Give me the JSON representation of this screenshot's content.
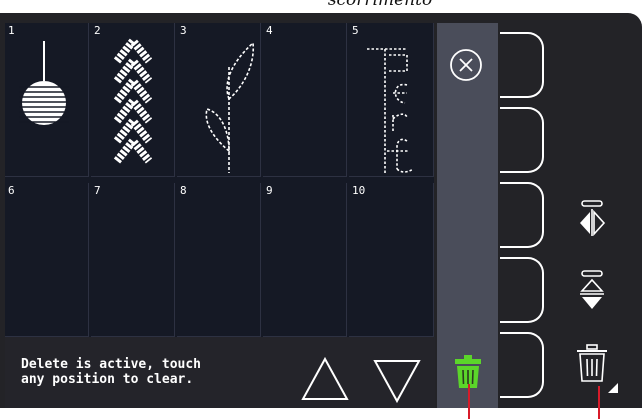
{
  "header": {
    "caption": "scorrimento"
  },
  "colors": {
    "accent_green": "#5bd52a",
    "callout_red": "#d81b2a",
    "grid_background": "#151925",
    "side_column": "#4a4d5a"
  },
  "stitch_slots": [
    {
      "number": "1",
      "pattern": "round-satin-ball"
    },
    {
      "number": "2",
      "pattern": "chevron-arrows"
    },
    {
      "number": "3",
      "pattern": "leaf-stem-outline"
    },
    {
      "number": "4",
      "pattern": ""
    },
    {
      "number": "5",
      "pattern": "dotted-script-letters"
    },
    {
      "number": "6",
      "pattern": ""
    },
    {
      "number": "7",
      "pattern": ""
    },
    {
      "number": "8",
      "pattern": ""
    },
    {
      "number": "9",
      "pattern": ""
    },
    {
      "number": "10",
      "pattern": ""
    }
  ],
  "message": {
    "text": "Delete is active, touch\nany position to clear."
  },
  "icons": {
    "close": "close-circle-icon",
    "scroll_up": "triangle-up-icon",
    "scroll_down": "triangle-down-icon",
    "delete_active": "trash-icon-green",
    "mirror_side": "mirror-side-to-side-icon",
    "mirror_end": "mirror-end-to-end-icon",
    "delete": "trash-icon"
  }
}
